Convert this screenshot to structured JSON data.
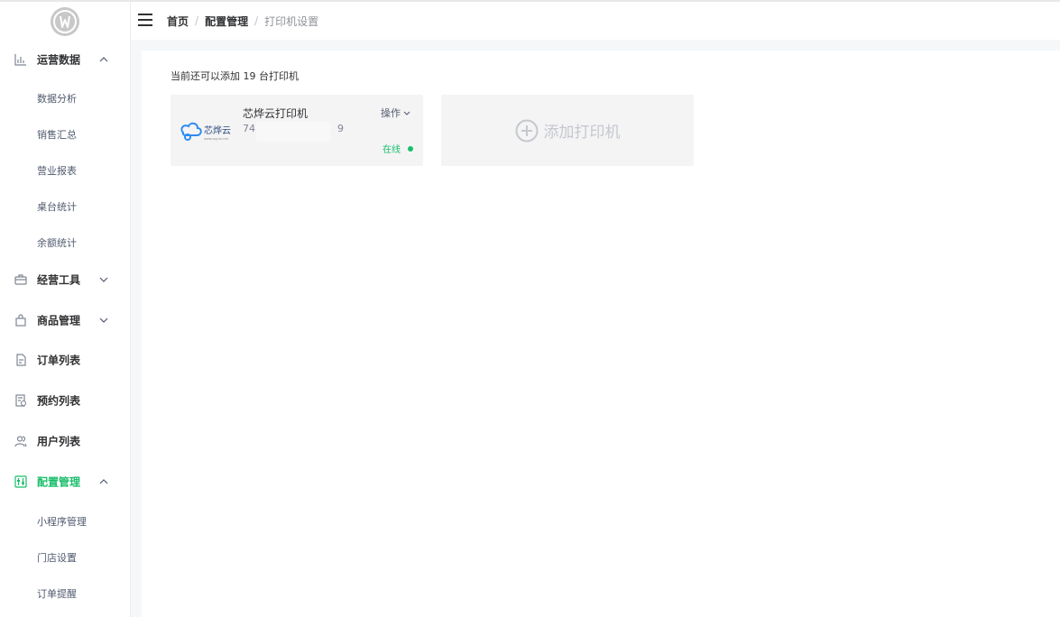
{
  "colors": {
    "accent": "#19be6b",
    "text": "#303133",
    "muted": "#909399",
    "card_bg": "#f4f4f5",
    "content_bg": "#f5f7f9"
  },
  "sidebar": {
    "logo_icon": "brand-logo-icon",
    "groups": [
      {
        "label": "运营数据",
        "icon": "bar-chart-icon",
        "expanded": true,
        "items": [
          "数据分析",
          "销售汇总",
          "营业报表",
          "桌台统计",
          "余额统计"
        ]
      },
      {
        "label": "经营工具",
        "icon": "briefcase-icon",
        "expanded": false
      },
      {
        "label": "商品管理",
        "icon": "shopping-bag-icon",
        "expanded": false
      },
      {
        "label": "订单列表",
        "icon": "document-icon"
      },
      {
        "label": "预约列表",
        "icon": "calendar-check-icon"
      },
      {
        "label": "用户列表",
        "icon": "users-icon"
      },
      {
        "label": "配置管理",
        "icon": "settings-sliders-icon",
        "expanded": true,
        "active": true,
        "items": [
          "小程序管理",
          "门店设置",
          "订单提醒"
        ]
      }
    ]
  },
  "header": {
    "breadcrumb": [
      "首页",
      "配置管理",
      "打印机设置"
    ],
    "separator": "/"
  },
  "main": {
    "summary": "当前还可以添加 19 台打印机",
    "printers": [
      {
        "name": "芯烨云打印机",
        "id_prefix": "74",
        "id_suffix": "9",
        "operation_label": "操作",
        "status": "在线",
        "brand_text": "芯烨云",
        "brand_url": "www.xpyun.net"
      }
    ],
    "add_label": "添加打印机"
  }
}
